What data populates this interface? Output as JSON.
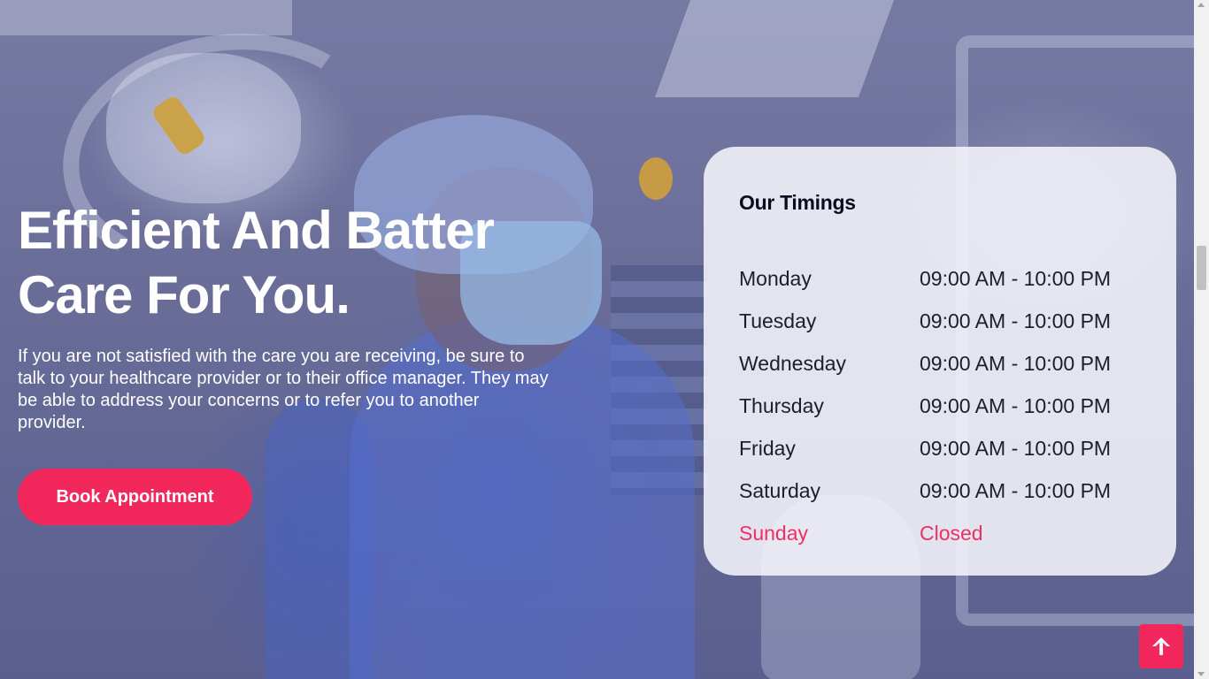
{
  "hero": {
    "headline_line1": "Efficient And Batter",
    "headline_line2": "Care For You.",
    "description": "If you are not satisfied with the care you are receiving, be sure to talk to your healthcare provider or to their office manager. They may be able to address your concerns or to refer you to another provider.",
    "cta_label": "Book Appointment"
  },
  "timings": {
    "title": "Our Timings",
    "rows": [
      {
        "day": "Monday",
        "hours": "09:00 AM - 10:00 PM"
      },
      {
        "day": "Tuesday",
        "hours": "09:00 AM - 10:00 PM"
      },
      {
        "day": "Wednesday",
        "hours": "09:00 AM - 10:00 PM"
      },
      {
        "day": "Thursday",
        "hours": "09:00 AM - 10:00 PM"
      },
      {
        "day": "Friday",
        "hours": "09:00 AM - 10:00 PM"
      },
      {
        "day": "Saturday",
        "hours": "09:00 AM - 10:00 PM"
      },
      {
        "day": "Sunday",
        "hours": "Closed"
      }
    ]
  },
  "back_to_top": {
    "icon": "arrow-up-icon"
  },
  "colors": {
    "accent": "#f2285d",
    "closed_text": "#ee2f64",
    "card_background": "#f5f5fa",
    "heading_text": "#ffffff",
    "overlay": "#5d6190"
  }
}
